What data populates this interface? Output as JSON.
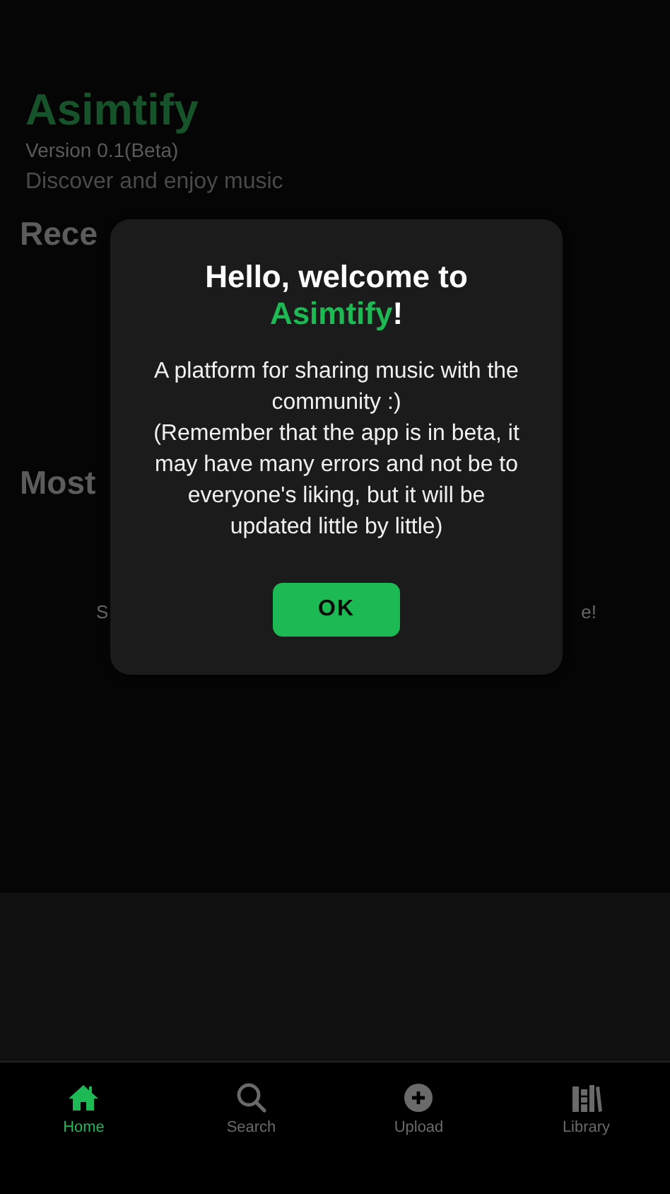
{
  "header": {
    "title": "Asimtify",
    "version": "Version 0.1(Beta)",
    "tagline": "Discover and enjoy music"
  },
  "sections": [
    {
      "title": "Rece"
    },
    {
      "title": "Most",
      "message_start": "S",
      "message_end": "e!"
    }
  ],
  "modal": {
    "title_start": "Hello, welcome to",
    "brand": "Asimtify",
    "title_end": "!",
    "body": [
      "A platform for sharing music with the community :)",
      "(Remember that the app is in beta, it may have many errors and not be to everyone's liking, but it will be updated little by little)"
    ],
    "button": "OK"
  },
  "nav": [
    {
      "label": "Home",
      "kind": "home",
      "selected": true
    },
    {
      "label": "Search",
      "kind": "search",
      "selected": false
    },
    {
      "label": "Upload",
      "kind": "upload",
      "selected": false
    },
    {
      "label": "Library",
      "kind": "library",
      "selected": false
    }
  ]
}
